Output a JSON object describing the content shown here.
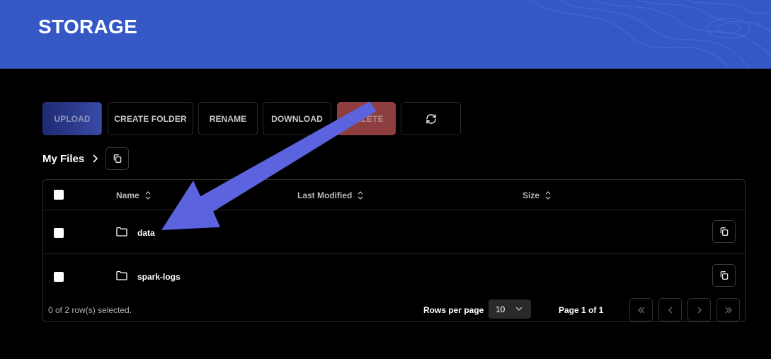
{
  "header": {
    "title": "STORAGE",
    "accent": "#3558c6"
  },
  "toolbar": {
    "upload": "UPLOAD",
    "create_folder": "CREATE FOLDER",
    "rename": "RENAME",
    "download": "DOWNLOAD",
    "delete": "DELETE",
    "refresh_icon": "refresh-icon"
  },
  "breadcrumb": {
    "label": "My Files",
    "separator_icon": "chevron-right-icon",
    "copy_icon": "copy-icon"
  },
  "table": {
    "columns": [
      "Name",
      "Last Modified",
      "Size"
    ],
    "rows": [
      {
        "name": "data",
        "type": "folder",
        "last_modified": "",
        "size": ""
      },
      {
        "name": "spark-logs",
        "type": "folder",
        "last_modified": "",
        "size": ""
      }
    ]
  },
  "footer": {
    "selection": "0 of 2 row(s) selected.",
    "rows_per_page_label": "Rows per page",
    "rows_per_page": "10",
    "page_info": "Page 1 of 1"
  },
  "annotation": {
    "type": "arrow",
    "color": "#5b63de",
    "points_to": "data"
  }
}
